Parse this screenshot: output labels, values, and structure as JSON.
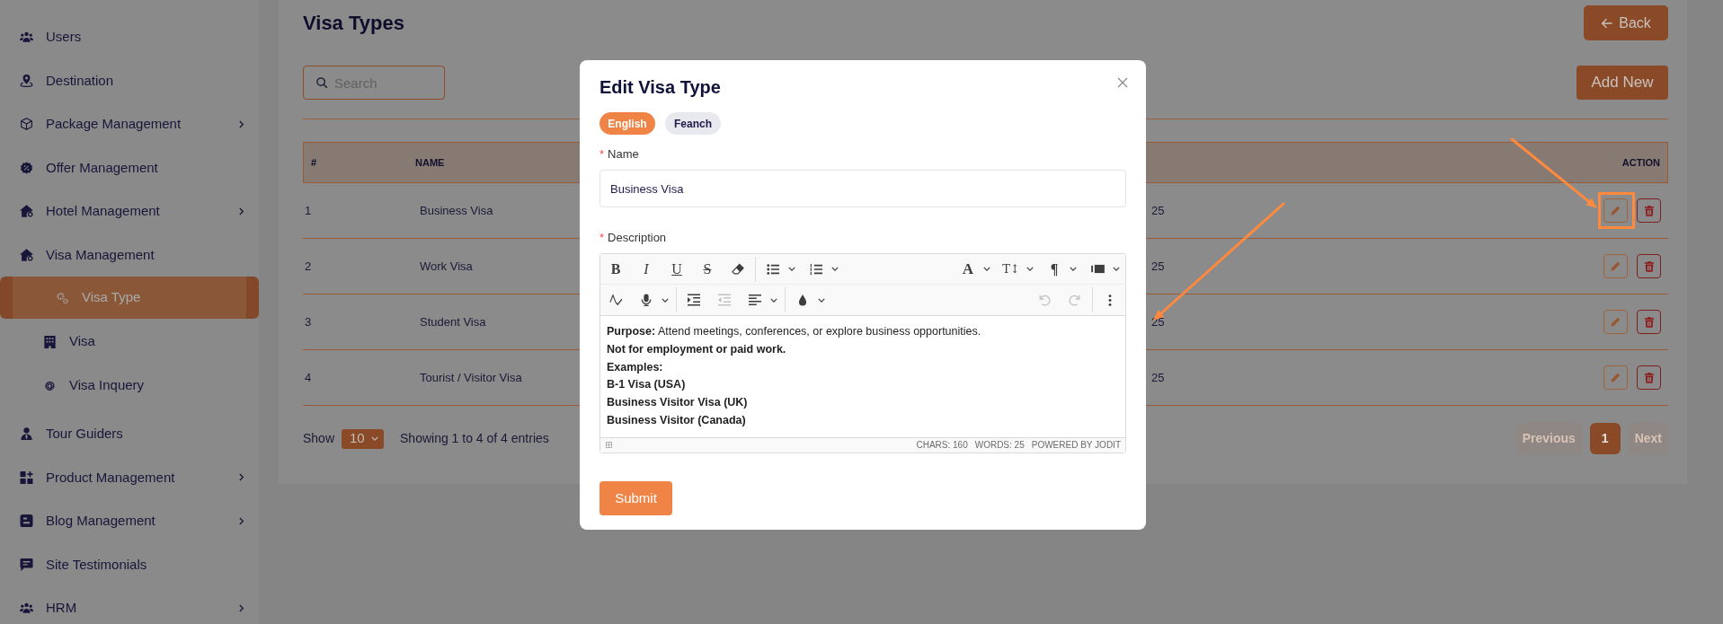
{
  "sidebar": {
    "items": [
      {
        "label": "Users",
        "kind": "link",
        "selected": false
      },
      {
        "label": "Destination",
        "kind": "link",
        "selected": false
      },
      {
        "label": "Package Management",
        "kind": "group",
        "expanded": false,
        "selected": false
      },
      {
        "label": "Offer Management",
        "kind": "link",
        "selected": false
      },
      {
        "label": "Hotel Management",
        "kind": "group",
        "expanded": false,
        "selected": false
      },
      {
        "label": "Visa Management",
        "kind": "group",
        "expanded": true,
        "selected": false,
        "children": [
          {
            "label": "Visa Type",
            "selected": true
          },
          {
            "label": "Visa",
            "selected": false
          },
          {
            "label": "Visa Inquery",
            "selected": false
          }
        ]
      },
      {
        "label": "Tour Guiders",
        "kind": "link",
        "selected": false
      },
      {
        "label": "Product Management",
        "kind": "group",
        "expanded": false,
        "selected": false
      },
      {
        "label": "Blog Management",
        "kind": "group",
        "expanded": false,
        "selected": false
      },
      {
        "label": "Site Testimonials",
        "kind": "link",
        "selected": false
      },
      {
        "label": "HRM",
        "kind": "group",
        "expanded": false,
        "selected": false
      }
    ]
  },
  "page": {
    "title": "Visa Types",
    "back_button": "Back",
    "add_button": "Add New",
    "search": {
      "placeholder": "Search"
    }
  },
  "table": {
    "columns": {
      "index": "#",
      "name": "NAME",
      "action": "ACTION"
    },
    "rows": [
      {
        "index": "1",
        "name": "Business Visa",
        "column_3": "25"
      },
      {
        "index": "2",
        "name": "Work Visa",
        "column_3": "25"
      },
      {
        "index": "3",
        "name": "Student Visa",
        "column_3": "25"
      },
      {
        "index": "4",
        "name": "Tourist / Visitor Visa",
        "column_3": "25"
      }
    ],
    "footer": {
      "show_label": "Show",
      "page_size": "10",
      "info": "Showing 1 to 4 of 4 entries",
      "pagination": [
        {
          "label": "Previous",
          "selected": false,
          "disabled": true
        },
        {
          "label": "1",
          "selected": true,
          "disabled": false
        },
        {
          "label": "Next",
          "selected": false,
          "disabled": true
        }
      ]
    }
  },
  "modal": {
    "title": "Edit Visa Type",
    "languages": [
      {
        "label": "English",
        "selected": true
      },
      {
        "label": "Feanch",
        "selected": false
      }
    ],
    "fields": [
      {
        "kind": "text",
        "required_mark": "*",
        "label": "Name",
        "value": "Business Visa"
      },
      {
        "kind": "editor",
        "required_mark": "*",
        "label": "Description",
        "toolbar": [
          {
            "start_groups": [
              [
                {
                  "kind": "bold",
                  "glyph": "B",
                  "disabled": false
                },
                {
                  "kind": "italic",
                  "glyph": "I",
                  "disabled": false
                },
                {
                  "kind": "underline",
                  "glyph": "U",
                  "disabled": false
                },
                {
                  "kind": "strikethrough",
                  "glyph": "S",
                  "disabled": false
                },
                {
                  "kind": "eraser",
                  "disabled": false
                }
              ],
              [
                {
                  "kind": "bullets",
                  "disabled": false
                },
                {
                  "kind": "numbering",
                  "disabled": false
                }
              ]
            ],
            "end_groups": [
              [
                {
                  "kind": "font",
                  "glyph": "A",
                  "disabled": false
                },
                {
                  "kind": "fontsize",
                  "glyph": "T↕",
                  "disabled": false
                },
                {
                  "kind": "paragraph",
                  "glyph": "¶",
                  "disabled": false
                },
                {
                  "kind": "block",
                  "disabled": false
                }
              ]
            ]
          },
          {
            "start_groups": [
              [
                {
                  "kind": "spellcheck",
                  "disabled": false
                },
                {
                  "kind": "microphone",
                  "disabled": false
                }
              ],
              [
                {
                  "kind": "indent",
                  "disabled": false
                },
                {
                  "kind": "outdent",
                  "disabled": true
                },
                {
                  "kind": "align",
                  "disabled": false
                }
              ],
              [
                {
                  "kind": "color",
                  "disabled": false
                }
              ]
            ],
            "end_groups": [
              [
                {
                  "kind": "undo",
                  "disabled": true
                },
                {
                  "kind": "redo",
                  "disabled": true
                }
              ],
              [
                {
                  "kind": "more",
                  "disabled": false
                }
              ]
            ]
          }
        ],
        "content": [
          {
            "text": "**Purpose:** Attend meetings, conferences, or explore business opportunities.",
            "bold": false
          },
          {
            "text": "Not for employment or paid work.",
            "bold": true
          },
          {
            "text": "Examples:",
            "bold": true
          },
          {
            "text": "B-1 Visa (USA)",
            "bold": true
          },
          {
            "text": "Business Visitor Visa (UK)",
            "bold": true
          },
          {
            "text": "Business Visitor (Canada)",
            "bold": true
          }
        ],
        "status": [
          "CHARS: 160",
          "WORDS: 25",
          "POWERED BY JODIT"
        ]
      }
    ],
    "submit": "Submit"
  },
  "annotations": [
    {
      "kind": "box"
    },
    {
      "kind": "arrow"
    },
    {
      "kind": "arrow"
    }
  ]
}
